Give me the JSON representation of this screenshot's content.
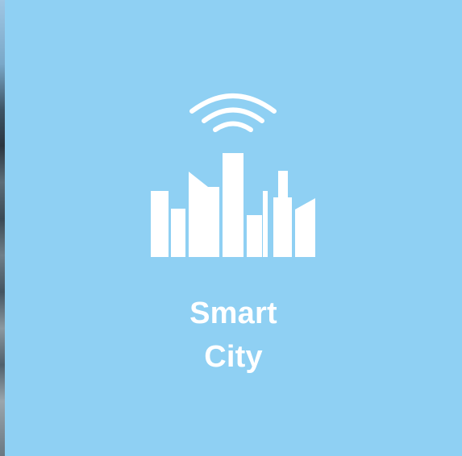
{
  "tile": {
    "title_line1": "Smart",
    "title_line2": "City",
    "background_color": "#8fd0f3",
    "foreground_color": "#ffffff",
    "icon": "smart-city-skyline-wifi-icon"
  }
}
